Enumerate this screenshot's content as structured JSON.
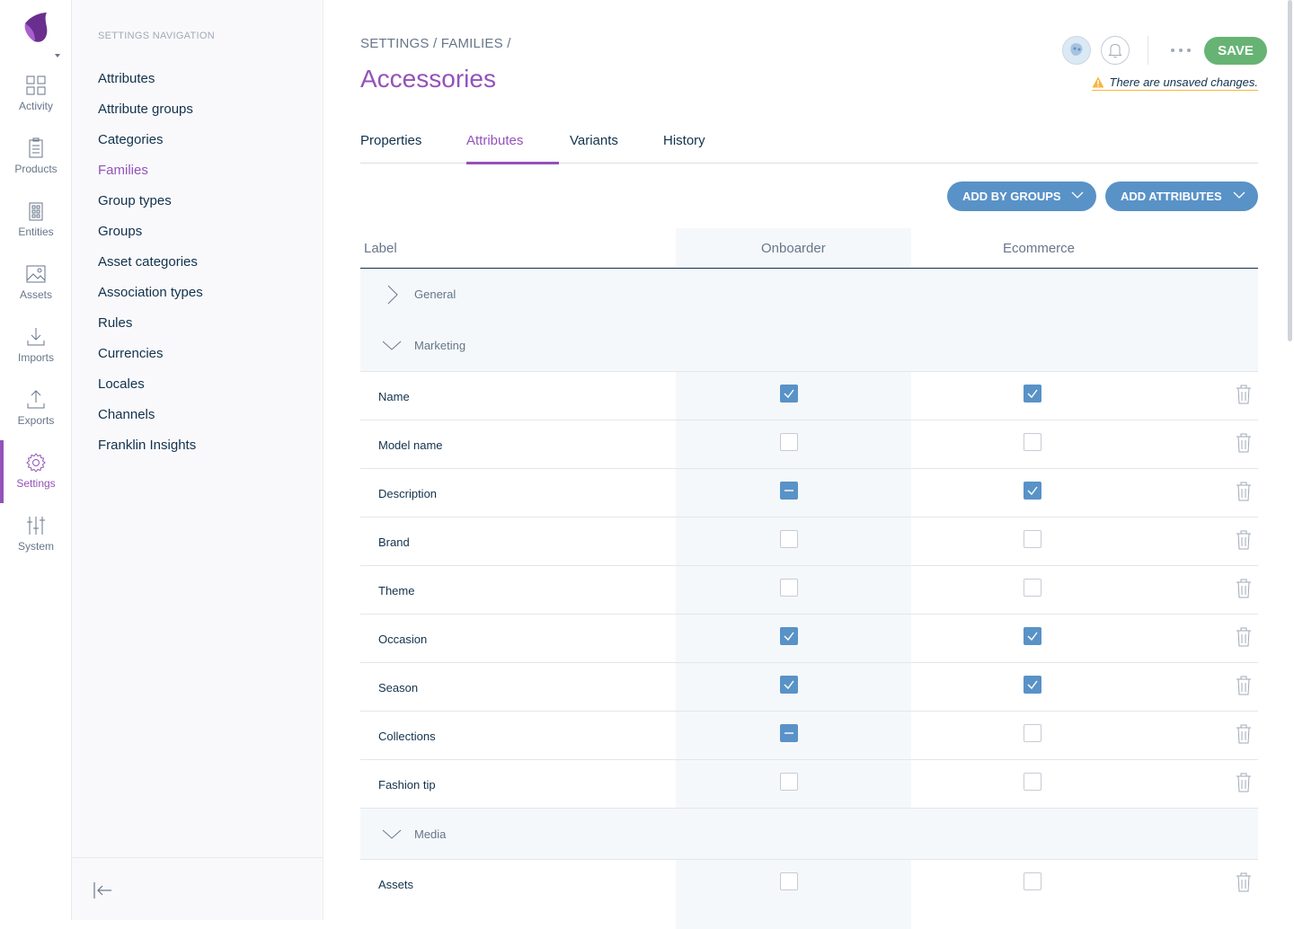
{
  "rail": {
    "items": [
      {
        "label": "Activity",
        "icon": "dashboard-icon"
      },
      {
        "label": "Products",
        "icon": "product-icon"
      },
      {
        "label": "Entities",
        "icon": "entities-icon"
      },
      {
        "label": "Assets",
        "icon": "assets-icon"
      },
      {
        "label": "Imports",
        "icon": "import-icon"
      },
      {
        "label": "Exports",
        "icon": "export-icon"
      },
      {
        "label": "Settings",
        "icon": "gear-icon"
      },
      {
        "label": "System",
        "icon": "sliders-icon"
      }
    ],
    "active": "Settings"
  },
  "subnav": {
    "title": "Settings navigation",
    "items": [
      "Attributes",
      "Attribute groups",
      "Categories",
      "Families",
      "Group types",
      "Groups",
      "Asset categories",
      "Association types",
      "Rules",
      "Currencies",
      "Locales",
      "Channels",
      "Franklin Insights"
    ],
    "active": "Families"
  },
  "header": {
    "breadcrumb": "Settings / Families /",
    "title": "Accessories",
    "save_label": "Save",
    "unsaved": "There are unsaved changes."
  },
  "tabs": [
    "Properties",
    "Attributes",
    "Variants",
    "History"
  ],
  "active_tab": "Attributes",
  "actions": {
    "add_by_groups": "Add by groups",
    "add_attributes": "Add attributes"
  },
  "table": {
    "columns": {
      "label": "Label",
      "channel1": "Onboarder",
      "channel2": "Ecommerce"
    },
    "groups": {
      "general": "General",
      "marketing": "Marketing",
      "media": "Media"
    },
    "rows": [
      {
        "label": "Name",
        "onboarder": "checked",
        "ecommerce": "checked"
      },
      {
        "label": "Model name",
        "onboarder": "unchecked",
        "ecommerce": "unchecked"
      },
      {
        "label": "Description",
        "onboarder": "mixed",
        "ecommerce": "checked"
      },
      {
        "label": "Brand",
        "onboarder": "unchecked",
        "ecommerce": "unchecked"
      },
      {
        "label": "Theme",
        "onboarder": "unchecked",
        "ecommerce": "unchecked"
      },
      {
        "label": "Occasion",
        "onboarder": "checked",
        "ecommerce": "checked"
      },
      {
        "label": "Season",
        "onboarder": "checked",
        "ecommerce": "checked"
      },
      {
        "label": "Collections",
        "onboarder": "mixed",
        "ecommerce": "unchecked"
      },
      {
        "label": "Fashion tip",
        "onboarder": "unchecked",
        "ecommerce": "unchecked"
      }
    ],
    "media_rows": [
      {
        "label": "Assets",
        "onboarder": "unchecked",
        "ecommerce": "unchecked"
      }
    ]
  },
  "colors": {
    "brand": "#9452ba",
    "save": "#67b373",
    "action_blue": "#5992c7",
    "warning": "#f9b53f"
  }
}
